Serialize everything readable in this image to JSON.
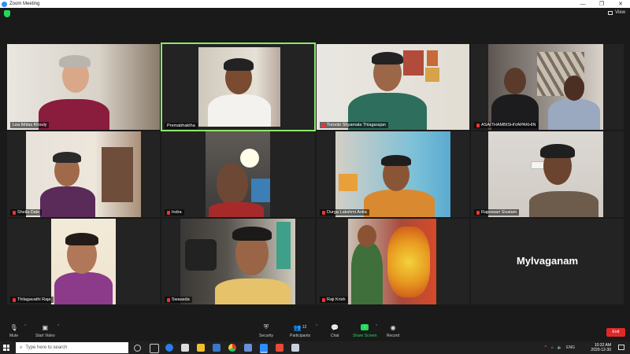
{
  "window": {
    "title": "Zoom Meeting",
    "controls": [
      "—",
      "❐",
      "✕"
    ]
  },
  "view_button": {
    "label": "View"
  },
  "participants": [
    {
      "name": "Lea Ikhlas Khouly",
      "muted": false
    },
    {
      "name": "Premabhaktha",
      "muted": false,
      "active_speaker": true
    },
    {
      "name": "Toronto Shyamala Thiagarajan",
      "muted": true
    },
    {
      "name": "ASAITHAMBISHIVAPAKHIN",
      "muted": true
    },
    {
      "name": "Sheila Dale",
      "muted": true
    },
    {
      "name": "Indra",
      "muted": true
    },
    {
      "name": "Durga Lakshmi Anita",
      "muted": true
    },
    {
      "name": "Rajeswari Sivalam",
      "muted": true
    },
    {
      "name": "Thilagavathi Raja",
      "muted": true
    },
    {
      "name": "Swaasda",
      "muted": true
    },
    {
      "name": "Raji Krish",
      "muted": true
    },
    {
      "name": "Mylvaganam",
      "muted": false,
      "video_off": true
    }
  ],
  "toolbar": {
    "mute": "Mute",
    "start_video": "Start Video",
    "security": "Security",
    "participants": "Participants",
    "participants_count": "12",
    "chat": "Chat",
    "share_screen": "Share Screen",
    "record": "Record",
    "end": "End"
  },
  "taskbar": {
    "search_placeholder": "Type here to search",
    "language": "ENG",
    "time": "10:32 AM",
    "date": "2020-12-30"
  },
  "colors": {
    "active_speaker_border": "#8ee86a",
    "share_green": "#23d959",
    "end_red": "#e02828"
  }
}
